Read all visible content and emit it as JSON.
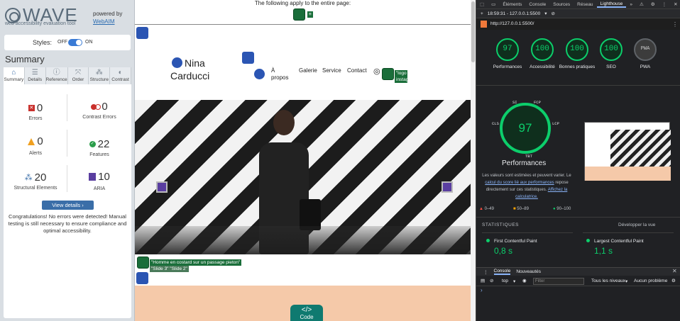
{
  "wave": {
    "logo": "WAVE",
    "subtitle": "web accessibility evaluation tool",
    "powered_by": "powered by",
    "webaim": "WebAIM",
    "styles_label": "Styles:",
    "styles_off": "OFF",
    "styles_on": "ON",
    "summary_title": "Summary",
    "tabs": [
      {
        "label": "Summary",
        "icon": "home-icon"
      },
      {
        "label": "Details",
        "icon": "list-icon"
      },
      {
        "label": "Reference",
        "icon": "info-icon"
      },
      {
        "label": "Order",
        "icon": "order-icon"
      },
      {
        "label": "Structure",
        "icon": "structure-icon"
      },
      {
        "label": "Contrast",
        "icon": "contrast-icon"
      }
    ],
    "stats": {
      "errors": {
        "value": "0",
        "label": "Errors"
      },
      "contrast_errors": {
        "value": "0",
        "label": "Contrast Errors"
      },
      "alerts": {
        "value": "0",
        "label": "Alerts"
      },
      "features": {
        "value": "22",
        "label": "Features"
      },
      "structural": {
        "value": "20",
        "label": "Structural Elements"
      },
      "aria": {
        "value": "10",
        "label": "ARIA"
      }
    },
    "view_details": "View details ›",
    "congrats": "Congratulations! No errors were detected! Manual testing is still necessary to ensure compliance and optimal accessibility."
  },
  "page": {
    "apply_note": "The following apply to the entire page:",
    "brand_line1": "Nina",
    "brand_line2": "Carducci",
    "nav": [
      "À propos",
      "Galerie",
      "Service",
      "Contact"
    ],
    "logo_instagram": "\"logo instagram\"",
    "caption": "\"Homme en costard sur un passage pieton\"",
    "slide_labels": "\"Slide 3\" \"Slide 2\"",
    "code_label": "Code"
  },
  "devtools": {
    "tabs": [
      "Éléments",
      "Console",
      "Sources",
      "Réseau",
      "Lighthouse"
    ],
    "active_tab": "Lighthouse",
    "session": "18:59:31 - 127.0.0.1:5500",
    "url": "http://127.0.0.1:5500/",
    "scores": [
      {
        "value": "97",
        "label": "Performances"
      },
      {
        "value": "100",
        "label": "Accessibilité"
      },
      {
        "value": "100",
        "label": "Bonnes pratiques"
      },
      {
        "value": "100",
        "label": "SEO"
      },
      {
        "value": "PWA",
        "label": "PWA"
      }
    ],
    "big_score": "97",
    "metric_tags": {
      "si": "SI",
      "fcp": "FCP",
      "cls": "CLS",
      "lcp": "LCP",
      "tbt": "TBT"
    },
    "perf_title": "Performances",
    "perf_text_1": "Les valeurs sont estimées et peuvent varier. Le",
    "perf_link_1": "calcul du score lié aux performances",
    "perf_text_2": "repose directement sur ces statistiques.",
    "perf_link_2": "Affichez la calculatrice.",
    "legend": [
      "0–49",
      "50–89",
      "90–100"
    ],
    "statistics": "STATISTIQUES",
    "expand_view": "Développer la vue",
    "metrics": [
      {
        "label": "First Contentful Paint",
        "value": "0,8 s"
      },
      {
        "label": "Largest Contentful Paint",
        "value": "1,1 s"
      }
    ],
    "drawer_tabs": [
      "Console",
      "Nouveautés"
    ],
    "console_context": "top",
    "filter_placeholder": "Filter",
    "levels": "Tous les niveaux",
    "issues": "Aucun problème"
  }
}
